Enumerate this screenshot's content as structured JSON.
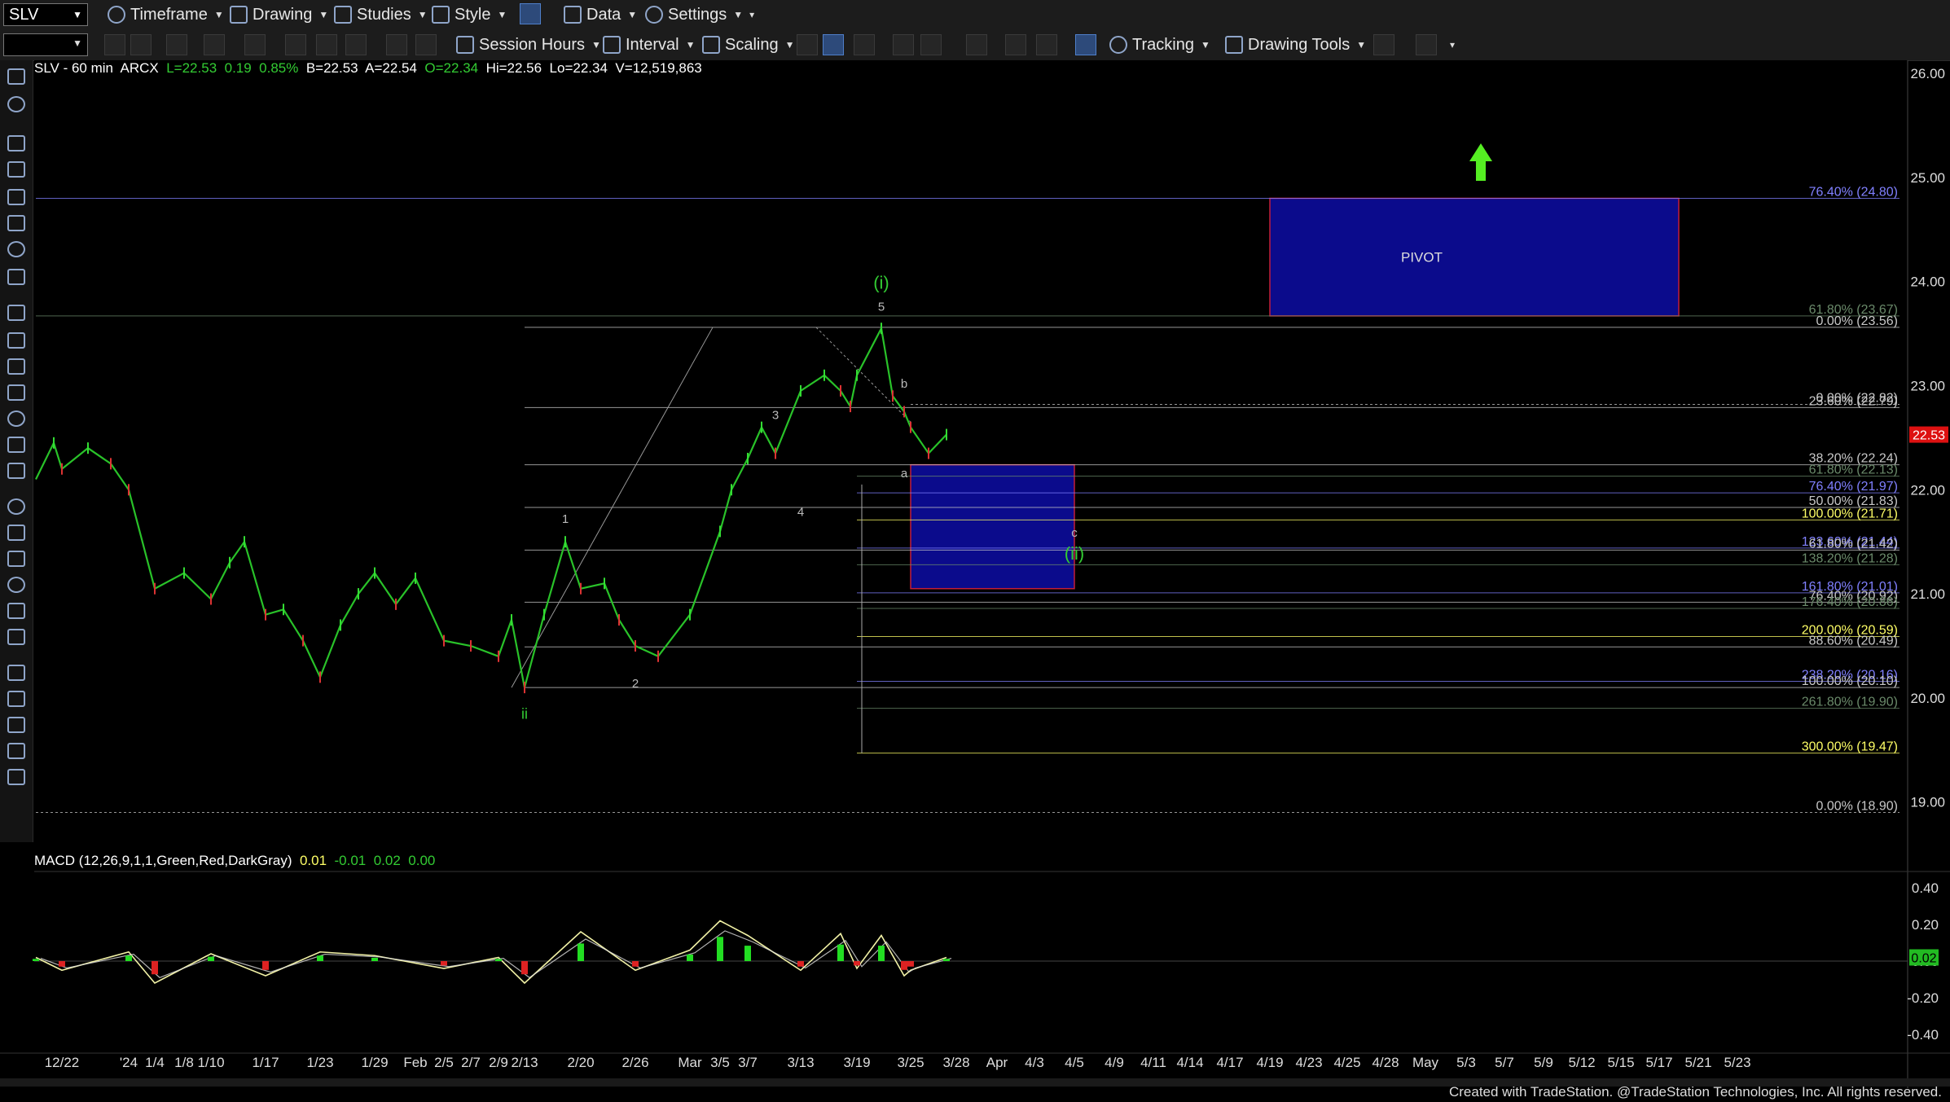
{
  "toolbar1": {
    "symbol": "SLV",
    "items": [
      "Timeframe",
      "Drawing",
      "Studies",
      "Style",
      "Data",
      "Settings"
    ]
  },
  "toolbar2": {
    "items": [
      "Session Hours",
      "Interval",
      "Scaling",
      "Tracking",
      "Drawing Tools"
    ]
  },
  "header": {
    "symbol": "SLV - 60 min",
    "exchange": "ARCX",
    "last": "L=22.53",
    "change": "0.19",
    "pct": "0.85%",
    "bid": "B=22.53",
    "ask": "A=22.54",
    "open": "O=22.34",
    "hi": "Hi=22.56",
    "lo": "Lo=22.34",
    "vol": "V=12,519,863"
  },
  "macd_header": {
    "label": "MACD (12,26,9,1,1,Green,Red,DarkGray)",
    "v1": "0.01",
    "v2": "-0.01",
    "v3": "0.02",
    "v4": "0.00"
  },
  "footer": "Created with TradeStation. @TradeStation Technologies, Inc. All rights reserved.",
  "chart_data": {
    "type": "line",
    "title": "SLV - 60 min",
    "ylim": [
      18.75,
      26.1
    ],
    "price_ticks": [
      26.0,
      25.0,
      24.0,
      23.0,
      22.0,
      21.0,
      20.0,
      19.0
    ],
    "macd_ylim": [
      -0.5,
      0.5
    ],
    "macd_ticks": [
      0.4,
      0.2,
      0.0,
      -0.2,
      -0.4
    ],
    "last_price": "22.53",
    "macd_last": "0.02",
    "x_labels": [
      "12/22",
      "'24",
      "1/4",
      "1/8",
      "1/10",
      "1/17",
      "1/23",
      "1/29",
      "Feb",
      "2/5",
      "2/7",
      "2/9",
      "2/13",
      "2/20",
      "2/26",
      "Mar",
      "3/5",
      "3/7",
      "3/13",
      "3/19",
      "3/25",
      "3/28",
      "Apr",
      "4/3",
      "4/5",
      "4/9",
      "4/11",
      "4/14",
      "4/17",
      "4/19",
      "4/23",
      "4/25",
      "4/28",
      "May",
      "5/3",
      "5/7",
      "5/9",
      "5/12",
      "5/15",
      "5/17",
      "5/21",
      "5/23"
    ],
    "price_path": [
      [
        "12/19",
        22.1
      ],
      [
        "12/21",
        22.45
      ],
      [
        "12/22",
        22.2
      ],
      [
        "12/26",
        22.4
      ],
      [
        "12/28",
        22.25
      ],
      [
        "'24",
        22.0
      ],
      [
        "1/4",
        21.05
      ],
      [
        "1/8",
        21.2
      ],
      [
        "1/10",
        20.95
      ],
      [
        "1/12",
        21.3
      ],
      [
        "1/14",
        21.5
      ],
      [
        "1/17",
        20.8
      ],
      [
        "1/19",
        20.85
      ],
      [
        "1/21",
        20.55
      ],
      [
        "1/23",
        20.2
      ],
      [
        "1/25",
        20.7
      ],
      [
        "1/27",
        21.0
      ],
      [
        "1/29",
        21.2
      ],
      [
        "1/31",
        20.9
      ],
      [
        "Feb",
        21.15
      ],
      [
        "2/5",
        20.55
      ],
      [
        "2/7",
        20.5
      ],
      [
        "2/9",
        20.4
      ],
      [
        "2/10",
        20.75
      ],
      [
        "2/13",
        20.1
      ],
      [
        "2/15",
        20.8
      ],
      [
        "2/17",
        21.5
      ],
      [
        "2/20",
        21.05
      ],
      [
        "2/22",
        21.1
      ],
      [
        "2/24",
        20.75
      ],
      [
        "2/26",
        20.5
      ],
      [
        "2/28",
        20.4
      ],
      [
        "Mar",
        20.8
      ],
      [
        "3/5",
        21.6
      ],
      [
        "3/6",
        22.0
      ],
      [
        "3/7",
        22.3
      ],
      [
        "3/9",
        22.6
      ],
      [
        "3/11",
        22.35
      ],
      [
        "3/13",
        22.95
      ],
      [
        "3/15",
        23.1
      ],
      [
        "3/17",
        22.95
      ],
      [
        "3/18",
        22.8
      ],
      [
        "3/19",
        23.1
      ],
      [
        "3/20",
        23.55
      ],
      [
        "3/21",
        22.9
      ],
      [
        "3/23",
        22.75
      ],
      [
        "3/25",
        22.6
      ],
      [
        "3/26",
        22.35
      ],
      [
        "3/27",
        22.53
      ]
    ],
    "macd_path": [
      [
        "12/19",
        0.02
      ],
      [
        "12/22",
        -0.05
      ],
      [
        "'24",
        0.05
      ],
      [
        "1/4",
        -0.12
      ],
      [
        "1/10",
        0.04
      ],
      [
        "1/17",
        -0.08
      ],
      [
        "1/23",
        0.05
      ],
      [
        "1/29",
        0.03
      ],
      [
        "2/5",
        -0.04
      ],
      [
        "2/9",
        0.02
      ],
      [
        "2/13",
        -0.12
      ],
      [
        "2/20",
        0.16
      ],
      [
        "2/26",
        -0.05
      ],
      [
        "Mar",
        0.06
      ],
      [
        "3/5",
        0.22
      ],
      [
        "3/7",
        0.14
      ],
      [
        "3/13",
        -0.05
      ],
      [
        "3/17",
        0.15
      ],
      [
        "3/19",
        -0.04
      ],
      [
        "3/20",
        0.14
      ],
      [
        "3/23",
        -0.08
      ],
      [
        "3/25",
        -0.05
      ],
      [
        "3/27",
        0.02
      ]
    ],
    "fib_levels": [
      {
        "label": "76.40% (24.80)",
        "price": 24.8,
        "color": "#8080ff",
        "from": "12/19"
      },
      {
        "label": "61.80% (23.67)",
        "price": 23.67,
        "color": "#6a8a6a",
        "from": "12/19"
      },
      {
        "label": "0.00% (23.56)",
        "price": 23.56,
        "color": "#c8c8c8",
        "from": "2/13"
      },
      {
        "label": "0.00% (22.82)",
        "price": 22.82,
        "color": "#c8c8c8",
        "from": "3/25"
      },
      {
        "label": "23.60% (22.79)",
        "price": 22.79,
        "color": "#c8c8c8",
        "from": "2/13"
      },
      {
        "label": "38.20% (22.24)",
        "price": 22.24,
        "color": "#c8c8c8",
        "from": "2/13"
      },
      {
        "label": "61.80% (22.13)",
        "price": 22.13,
        "color": "#6a8a6a",
        "from": "3/19"
      },
      {
        "label": "76.40% (21.97)",
        "price": 21.97,
        "color": "#8080ff",
        "from": "3/19"
      },
      {
        "label": "50.00% (21.83)",
        "price": 21.83,
        "color": "#c8c8c8",
        "from": "2/13"
      },
      {
        "label": "100.00% (21.71)",
        "price": 21.71,
        "color": "#ffff66",
        "from": "3/19"
      },
      {
        "label": "123.60% (21.44)",
        "price": 21.44,
        "color": "#8080ff",
        "from": "3/19"
      },
      {
        "label": "61.80% (21.42)",
        "price": 21.42,
        "color": "#c8c8c8",
        "from": "2/13"
      },
      {
        "label": "138.20% (21.28)",
        "price": 21.28,
        "color": "#6a8a6a",
        "from": "3/19"
      },
      {
        "label": "161.80% (21.01)",
        "price": 21.01,
        "color": "#8080ff",
        "from": "3/19"
      },
      {
        "label": "76.40% (20.92)",
        "price": 20.92,
        "color": "#c8c8c8",
        "from": "2/13"
      },
      {
        "label": "176.40% (20.86)",
        "price": 20.86,
        "color": "#6a8a6a",
        "from": "3/19"
      },
      {
        "label": "200.00% (20.59)",
        "price": 20.59,
        "color": "#ffff66",
        "from": "3/19"
      },
      {
        "label": "88.60% (20.49)",
        "price": 20.49,
        "color": "#c8c8c8",
        "from": "2/13"
      },
      {
        "label": "238.20% (20.16)",
        "price": 20.16,
        "color": "#8080ff",
        "from": "3/19"
      },
      {
        "label": "100.00% (20.10)",
        "price": 20.1,
        "color": "#c8c8c8",
        "from": "2/13"
      },
      {
        "label": "261.80% (19.90)",
        "price": 19.9,
        "color": "#6a8a6a",
        "from": "3/19"
      },
      {
        "label": "300.00% (19.47)",
        "price": 19.47,
        "color": "#ffff66",
        "from": "3/19"
      },
      {
        "label": "0.00% (18.90)",
        "price": 18.9,
        "color": "#c8c8c8",
        "from": "12/19"
      }
    ],
    "boxes": [
      {
        "label": "PIVOT",
        "from": "4/19",
        "to": "5/19",
        "top": 24.8,
        "bottom": 23.67
      },
      {
        "label": "",
        "from": "3/25",
        "to": "4/5",
        "top": 22.24,
        "bottom": 21.05
      }
    ],
    "wave_labels": [
      {
        "text": "(i)",
        "x": "3/20",
        "price": 23.93,
        "color": "#33cc33",
        "size": 22
      },
      {
        "text": "5",
        "x": "3/20",
        "price": 23.72,
        "color": "#bbbbbb",
        "size": 15
      },
      {
        "text": "b",
        "x": "3/23",
        "price": 22.98,
        "color": "#bbbbbb",
        "size": 15
      },
      {
        "text": "3",
        "x": "3/11",
        "price": 22.68,
        "color": "#bbbbbb",
        "size": 15
      },
      {
        "text": "a",
        "x": "3/23",
        "price": 22.12,
        "color": "#bbbbbb",
        "size": 15
      },
      {
        "text": "4",
        "x": "3/13",
        "price": 21.75,
        "color": "#bbbbbb",
        "size": 15
      },
      {
        "text": "1",
        "x": "2/17",
        "price": 21.68,
        "color": "#bbbbbb",
        "size": 15
      },
      {
        "text": "c",
        "x": "4/5",
        "price": 21.55,
        "color": "#bbbbbb",
        "size": 15
      },
      {
        "text": "(ii)",
        "x": "4/5",
        "price": 21.33,
        "color": "#33cc33",
        "size": 22
      },
      {
        "text": "2",
        "x": "2/26",
        "price": 20.1,
        "color": "#bbbbbb",
        "size": 15
      },
      {
        "text": "ii",
        "x": "2/13",
        "price": 19.8,
        "color": "#33cc33",
        "size": 18
      }
    ],
    "arrow_x": "5/1",
    "legend": "none",
    "grid": false
  }
}
